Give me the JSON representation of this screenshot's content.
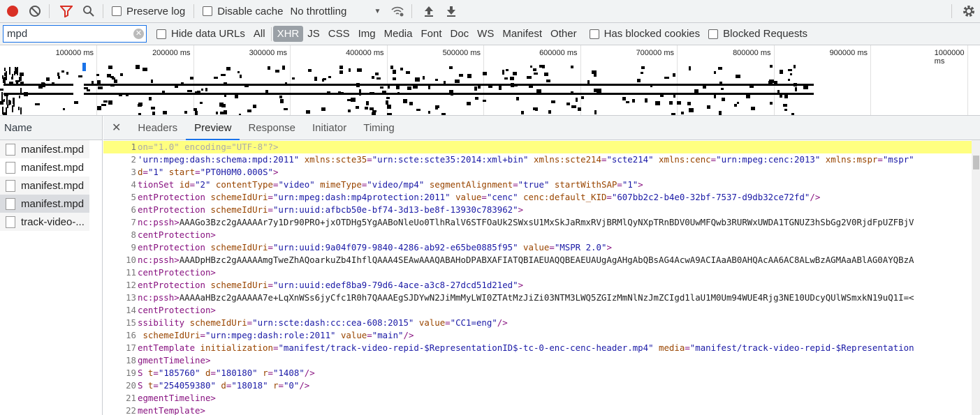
{
  "toolbar": {
    "preserve_log": "Preserve log",
    "disable_cache": "Disable cache",
    "throttling": "No throttling"
  },
  "filter": {
    "value": "mpd",
    "hide_data_urls": "Hide data URLs",
    "types": [
      "All",
      "XHR",
      "JS",
      "CSS",
      "Img",
      "Media",
      "Font",
      "Doc",
      "WS",
      "Manifest",
      "Other"
    ],
    "active_type": "XHR",
    "has_blocked_cookies": "Has blocked cookies",
    "blocked_requests": "Blocked Requests"
  },
  "overview": {
    "ticks": [
      "100000 ms",
      "200000 ms",
      "300000 ms",
      "400000 ms",
      "500000 ms",
      "600000 ms",
      "700000 ms",
      "800000 ms",
      "900000 ms",
      "1000000 ms"
    ]
  },
  "requests": {
    "header": "Name",
    "items": [
      "manifest.mpd",
      "manifest.mpd",
      "manifest.mpd",
      "manifest.mpd",
      "track-video-..."
    ]
  },
  "detail": {
    "tabs": [
      "Headers",
      "Preview",
      "Response",
      "Initiator",
      "Timing"
    ],
    "active_tab": "Preview"
  },
  "code": [
    [
      [
        "g",
        "on=\"1.0\" encoding=\"UTF-8\"?>"
      ]
    ],
    [
      [
        "v",
        "'urn:mpeg:dash:schema:mpd:2011\" "
      ],
      [
        "a",
        "xmlns:scte35"
      ],
      [
        "t",
        "="
      ],
      [
        "v",
        "\"urn:scte:scte35:2014:xml+bin\" "
      ],
      [
        "a",
        "xmlns:scte214"
      ],
      [
        "t",
        "="
      ],
      [
        "v",
        "\"scte214\" "
      ],
      [
        "a",
        "xmlns:cenc"
      ],
      [
        "t",
        "="
      ],
      [
        "v",
        "\"urn:mpeg:cenc:2013\" "
      ],
      [
        "a",
        "xmlns:mspr"
      ],
      [
        "t",
        "="
      ],
      [
        "v",
        "\"mspr\""
      ]
    ],
    [
      [
        "a",
        "d"
      ],
      [
        "t",
        "="
      ],
      [
        "v",
        "\"1\" "
      ],
      [
        "a",
        "start"
      ],
      [
        "t",
        "="
      ],
      [
        "v",
        "\"PT0H0M0.000S\""
      ],
      [
        "t",
        ">"
      ]
    ],
    [
      [
        "t",
        "tionSet "
      ],
      [
        "a",
        "id"
      ],
      [
        "t",
        "="
      ],
      [
        "v",
        "\"2\" "
      ],
      [
        "a",
        "contentType"
      ],
      [
        "t",
        "="
      ],
      [
        "v",
        "\"video\" "
      ],
      [
        "a",
        "mimeType"
      ],
      [
        "t",
        "="
      ],
      [
        "v",
        "\"video/mp4\" "
      ],
      [
        "a",
        "segmentAlignment"
      ],
      [
        "t",
        "="
      ],
      [
        "v",
        "\"true\" "
      ],
      [
        "a",
        "startWithSAP"
      ],
      [
        "t",
        "="
      ],
      [
        "v",
        "\"1\""
      ],
      [
        "t",
        ">"
      ]
    ],
    [
      [
        "t",
        "entProtection "
      ],
      [
        "a",
        "schemeIdUri"
      ],
      [
        "t",
        "="
      ],
      [
        "v",
        "\"urn:mpeg:dash:mp4protection:2011\" "
      ],
      [
        "a",
        "value"
      ],
      [
        "t",
        "="
      ],
      [
        "v",
        "\"cenc\" "
      ],
      [
        "a",
        "cenc:default_KID"
      ],
      [
        "t",
        "="
      ],
      [
        "v",
        "\"607bb2c2-b4e0-32bf-7537-d9db32ce72fd\""
      ],
      [
        "t",
        "/>"
      ]
    ],
    [
      [
        "t",
        "entProtection "
      ],
      [
        "a",
        "schemeIdUri"
      ],
      [
        "t",
        "="
      ],
      [
        "v",
        "\"urn:uuid:afbcb50e-bf74-3d13-be8f-13930c783962\""
      ],
      [
        "t",
        ">"
      ]
    ],
    [
      [
        "t",
        "nc:pssh>"
      ],
      [
        "c",
        "AAAGo3Bzc2gAAAAAr7y1Dr90PRO+jxOTDHg5YgAABoNleUo0TlhRalV6STFOaUk2SWxsU1MxSkJaRmxRVjBRMlQyNXpTRnBDV0UwMFQwb3RURWxUWDA1TGNUZ3hSbGg2V0RjdFpUZFBjV"
      ]
    ],
    [
      [
        "t",
        "centProtection>"
      ]
    ],
    [
      [
        "t",
        "entProtection "
      ],
      [
        "a",
        "schemeIdUri"
      ],
      [
        "t",
        "="
      ],
      [
        "v",
        "\"urn:uuid:9a04f079-9840-4286-ab92-e65be0885f95\" "
      ],
      [
        "a",
        "value"
      ],
      [
        "t",
        "="
      ],
      [
        "v",
        "\"MSPR 2.0\""
      ],
      [
        "t",
        ">"
      ]
    ],
    [
      [
        "t",
        "nc:pssh>"
      ],
      [
        "c",
        "AAADpHBzc2gAAAAAmgTweZhAQoarkuZb4IhflQAAA4SEAwAAAQABAHoDPABXAFIATQBIAEUAQQBEAEUAUgAgAHgAbQBsAG4AcwA9ACIAaAB0AHQAcAA6AC8ALwBzAGMAaABlAG0AYQBzA"
      ]
    ],
    [
      [
        "t",
        "centProtection>"
      ]
    ],
    [
      [
        "t",
        "entProtection "
      ],
      [
        "a",
        "schemeIdUri"
      ],
      [
        "t",
        "="
      ],
      [
        "v",
        "\"urn:uuid:edef8ba9-79d6-4ace-a3c8-27dcd51d21ed\""
      ],
      [
        "t",
        ">"
      ]
    ],
    [
      [
        "t",
        "nc:pssh>"
      ],
      [
        "c",
        "AAAAaHBzc2gAAAAA7e+LqXnWSs6jyCfc1R0h7QAAAEgSJDYwN2JiMmMyLWI0ZTAtMzJiZi03NTM3LWQ5ZGIzMmNlNzJmZCIgd1laU1M0Um94WUE4Rjg3NE10UDcyQUlWSmxkN19uQ1I=<"
      ]
    ],
    [
      [
        "t",
        "centProtection>"
      ]
    ],
    [
      [
        "t",
        "ssibility "
      ],
      [
        "a",
        "schemeIdUri"
      ],
      [
        "t",
        "="
      ],
      [
        "v",
        "\"urn:scte:dash:cc:cea-608:2015\" "
      ],
      [
        "a",
        "value"
      ],
      [
        "t",
        "="
      ],
      [
        "v",
        "\"CC1=eng\""
      ],
      [
        "t",
        "/>"
      ]
    ],
    [
      [
        "t",
        " "
      ],
      [
        "a",
        "schemeIdUri"
      ],
      [
        "t",
        "="
      ],
      [
        "v",
        "\"urn:mpeg:dash:role:2011\" "
      ],
      [
        "a",
        "value"
      ],
      [
        "t",
        "="
      ],
      [
        "v",
        "\"main\""
      ],
      [
        "t",
        "/>"
      ]
    ],
    [
      [
        "t",
        "entTemplate "
      ],
      [
        "a",
        "initialization"
      ],
      [
        "t",
        "="
      ],
      [
        "v",
        "\"manifest/track-video-repid-$RepresentationID$-tc-0-enc-cenc-header.mp4\" "
      ],
      [
        "a",
        "media"
      ],
      [
        "t",
        "="
      ],
      [
        "v",
        "\"manifest/track-video-repid-$Representation"
      ]
    ],
    [
      [
        "t",
        "gmentTimeline>"
      ]
    ],
    [
      [
        "t",
        "S "
      ],
      [
        "a",
        "t"
      ],
      [
        "t",
        "="
      ],
      [
        "v",
        "\"185760\" "
      ],
      [
        "a",
        "d"
      ],
      [
        "t",
        "="
      ],
      [
        "v",
        "\"180180\" "
      ],
      [
        "a",
        "r"
      ],
      [
        "t",
        "="
      ],
      [
        "v",
        "\"1408\""
      ],
      [
        "t",
        "/>"
      ]
    ],
    [
      [
        "t",
        "S "
      ],
      [
        "a",
        "t"
      ],
      [
        "t",
        "="
      ],
      [
        "v",
        "\"254059380\" "
      ],
      [
        "a",
        "d"
      ],
      [
        "t",
        "="
      ],
      [
        "v",
        "\"18018\" "
      ],
      [
        "a",
        "r"
      ],
      [
        "t",
        "="
      ],
      [
        "v",
        "\"0\""
      ],
      [
        "t",
        "/>"
      ]
    ],
    [
      [
        "t",
        "egmentTimeline>"
      ]
    ],
    [
      [
        "t",
        "mentTemplate>"
      ]
    ]
  ]
}
